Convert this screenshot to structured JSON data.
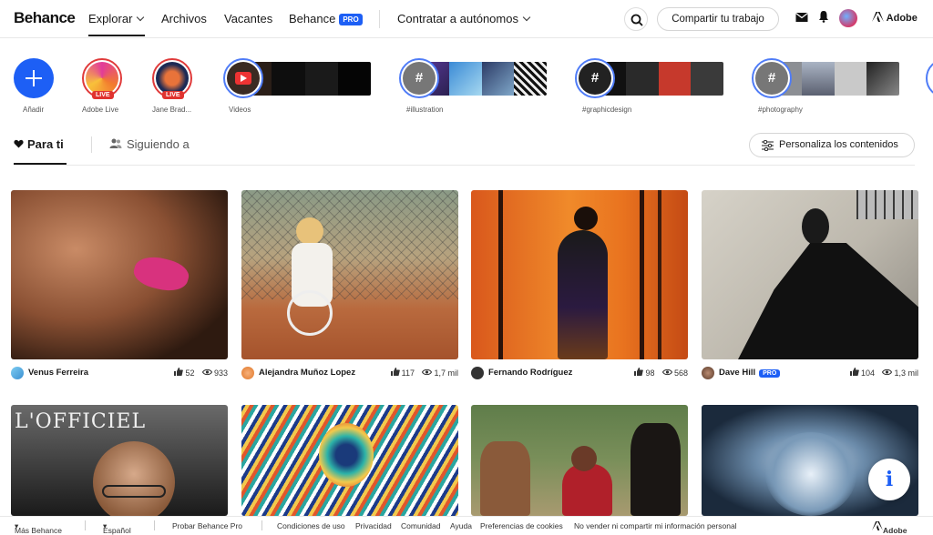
{
  "header": {
    "logo": "Behance",
    "nav": {
      "explorar": "Explorar",
      "archivos": "Archivos",
      "vacantes": "Vacantes",
      "behance": "Behance",
      "behance_badge": "PRO",
      "contratar": "Contratar a autónomos"
    },
    "share_label": "Compartir tu trabajo",
    "adobe_label": "Adobe",
    "icons": [
      "search-icon",
      "mail-icon",
      "bell-icon",
      "user-avatar",
      "adobe-logo"
    ]
  },
  "stories": {
    "add_label": "Añadir",
    "adobe_live_label": "Adobe Live",
    "jane_label": "Jane Brad...",
    "live_badge": "LIVE",
    "videos_label": "Videos",
    "illustration_label": "#illustration",
    "graphicdesign_label": "#graphicdesign",
    "photography_label": "#photography",
    "hash": "#"
  },
  "tabs": {
    "para_ti": "Para ti",
    "siguiendo": "Siguiendo a",
    "personaliza": "Personaliza los contenidos"
  },
  "projects": [
    {
      "owner": "Venus Ferreira",
      "likes": "52",
      "views": "933",
      "pro": false
    },
    {
      "owner": "Alejandra Muñoz Lopez",
      "likes": "117",
      "views": "1,7 mil",
      "pro": false
    },
    {
      "owner": "Fernando Rodríguez",
      "likes": "98",
      "views": "568",
      "pro": false
    },
    {
      "owner": "Dave Hill",
      "likes": "104",
      "views": "1,3 mil",
      "pro": true,
      "pro_label": "PRO"
    }
  ],
  "second_row_text": {
    "magazine": "L'OFFICIEL"
  },
  "footer": {
    "mas_behance": "Más Behance",
    "espanol": "Español",
    "probar": "Probar Behance Pro",
    "condiciones": "Condiciones de uso",
    "privacidad": "Privacidad",
    "comunidad": "Comunidad",
    "ayuda": "Ayuda",
    "cookies": "Preferencias de cookies",
    "no_vender": "No vender ni compartir mi información personal",
    "adobe": "Adobe"
  },
  "info_button": "i",
  "colors": {
    "accent": "#1d5ff5",
    "live": "#e0332f",
    "text": "#191919"
  }
}
